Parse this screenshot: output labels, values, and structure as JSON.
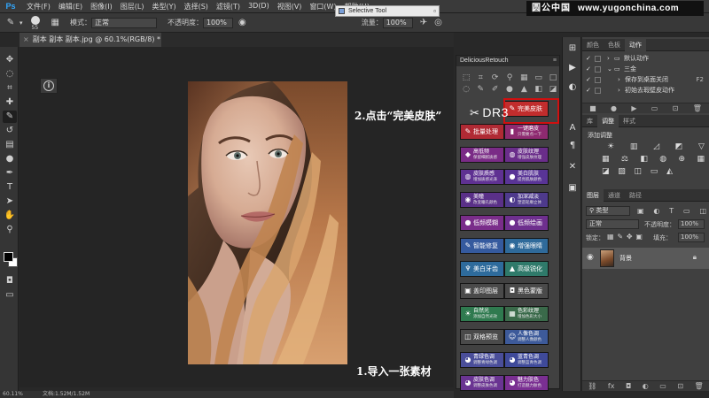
{
  "app": {
    "logo": "Ps"
  },
  "menu": [
    "文件(F)",
    "编辑(E)",
    "图像(I)",
    "图层(L)",
    "类型(Y)",
    "选择(S)",
    "滤镜(T)",
    "3D(D)",
    "视图(V)",
    "窗口(W)",
    "帮助(H)"
  ],
  "brand": {
    "name": "圆公中国",
    "url": "www.yugonchina.com"
  },
  "options": {
    "brush_size": "55",
    "mode_label": "模式：",
    "mode_value": "正常",
    "opacity_label": "不透明度：",
    "opacity_value": "100%",
    "flow_label": "流量：",
    "flow_value": "100%"
  },
  "selective_tool": {
    "title": "Selective Tool"
  },
  "document": {
    "tab_title": "副本 副本 副本.jpg @ 60.1%(RGB/8) *"
  },
  "annotations": {
    "import": "1.导入一张素材",
    "click": "2.点击“完美皮肤”"
  },
  "dr_label": "DR3",
  "dr_panel": {
    "title": "DeliciousRetouch",
    "buttons": [
      {
        "label": "完美皮肤",
        "icon": "brush-icon",
        "color": "#c12d2d"
      },
      {
        "label": "批量处理",
        "icon": "brush-icon",
        "color": "#b02a34"
      },
      {
        "label": "一键磨皮",
        "sub": "只需要点一下",
        "icon": "bottle-icon",
        "color": "#8e2a70"
      },
      {
        "label": "高低频",
        "sub": "保留细腻质感",
        "icon": "diamond-icon",
        "color": "#7a2b86"
      },
      {
        "label": "皮肤纹理",
        "sub": "增强皮肤纹理",
        "icon": "globe-icon",
        "color": "#6a2d8a"
      },
      {
        "label": "皮肤质感",
        "sub": "增加质感光泽",
        "icon": "globe-icon",
        "color": "#5f3192"
      },
      {
        "label": "美白肌肤",
        "sub": "提亮肌肤颜色",
        "icon": "drop-icon",
        "color": "#593496"
      },
      {
        "label": "美瞳",
        "sub": "改变瞳孔颜色",
        "icon": "eye-icon",
        "color": "#5a3088"
      },
      {
        "label": "加深减淡",
        "sub": "塑造轮廓立体",
        "icon": "half-circle-icon",
        "color": "#4e3a8c"
      },
      {
        "label": "低频模糊",
        "icon": "drop-icon",
        "color": "#7a2d8a"
      },
      {
        "label": "低频绘画",
        "icon": "drop-icon",
        "color": "#6e2f8e"
      },
      {
        "label": "智能修复",
        "icon": "brush-icon",
        "color": "#355a9e"
      },
      {
        "label": "增强眼睛",
        "icon": "eye-icon",
        "color": "#2f6a9a"
      },
      {
        "label": "美白牙齿",
        "icon": "tooth-icon",
        "color": "#2e6b9c"
      },
      {
        "label": "高级锐化",
        "icon": "triangle-icon",
        "color": "#2f7a6a"
      },
      {
        "label": "盖印图层",
        "icon": "layers-icon",
        "color": "#4a4a4a"
      },
      {
        "label": "黑色蒙版",
        "icon": "mask-icon",
        "color": "#4a4a4a"
      },
      {
        "label": "自然光",
        "sub": "添加自然光效",
        "icon": "sun-icon",
        "color": "#2f7a4f"
      },
      {
        "label": "色彩纹理",
        "sub": "增加色彩大小",
        "icon": "grid-icon",
        "color": "#3a6a4a"
      },
      {
        "label": "双格预览",
        "icon": "split-icon",
        "color": "#4a4a4a"
      },
      {
        "label": "人像色调",
        "sub": "调整人像颜色",
        "icon": "person-icon",
        "color": "#3d5a9a"
      },
      {
        "label": "青绿色调",
        "sub": "调整青绿色调",
        "icon": "palette-icon",
        "color": "#4a4e9a"
      },
      {
        "label": "蓝青色调",
        "sub": "调整蓝青色调",
        "icon": "palette-icon",
        "color": "#3f4a9a"
      },
      {
        "label": "皮肤色调",
        "sub": "调整皮肤色调",
        "icon": "palette-icon",
        "color": "#6a3492"
      },
      {
        "label": "魅力肤色",
        "sub": "打造魅力肤色",
        "icon": "palette-icon",
        "color": "#7a2f92"
      }
    ]
  },
  "actions_panel": {
    "tabs": [
      "颜色",
      "色板",
      "动作"
    ],
    "active_tab": "动作",
    "items": [
      {
        "label": "默认动作",
        "key": ""
      },
      {
        "label": "三金",
        "key": ""
      },
      {
        "label": "保存到桌面关闭",
        "key": "F2"
      },
      {
        "label": "初始去瑕壁皮动作",
        "key": ""
      }
    ]
  },
  "adjust_panel": {
    "tabs": [
      "库",
      "调整",
      "样式"
    ],
    "active_tab": "调整",
    "title": "添加调整"
  },
  "layers_panel": {
    "tabs": [
      "图层",
      "通道",
      "路径"
    ],
    "active_tab": "图层",
    "filter": "类型",
    "blend": "正常",
    "opacity_label": "不透明度：",
    "opacity_value": "100%",
    "lock_label": "锁定：",
    "fill_label": "填充：",
    "fill_value": "100%",
    "layer_name": "背景"
  },
  "status": {
    "zoom": "60.11%",
    "doc": "文档:1.52M/1.52M"
  }
}
